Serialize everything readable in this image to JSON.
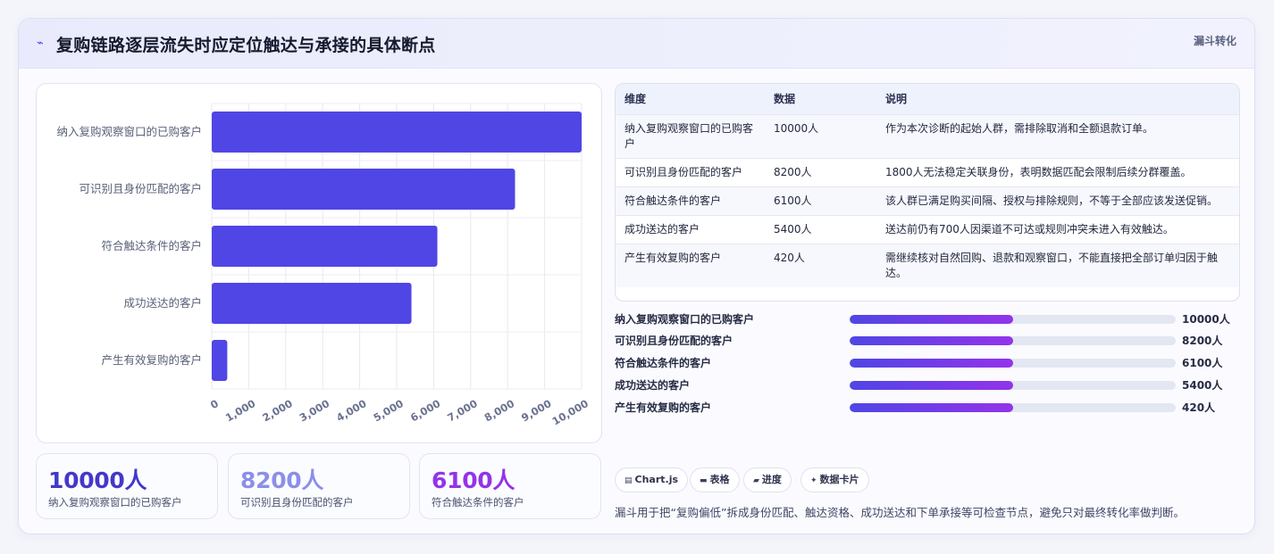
{
  "header": {
    "title_icon": "chart-spark-icon",
    "title": "复购链路逐层流失时应定位触达与承接的具体断点",
    "tag": "漏斗转化"
  },
  "colors": {
    "bar": "#4f46e5",
    "stat_1": "#4338ca",
    "stat_2": "#8b8fe8",
    "stat_3": "#9333ea",
    "progress_from": "#5046e5",
    "progress_to": "#9333ea"
  },
  "chart_data": {
    "type": "bar",
    "orientation": "horizontal",
    "categories": [
      "纳入复购观察窗口的已购客户",
      "可识别且身份匹配的客户",
      "符合触达条件的客户",
      "成功送达的客户",
      "产生有效复购的客户"
    ],
    "values": [
      10000,
      8200,
      6100,
      5400,
      420
    ],
    "xlim": [
      0,
      10000
    ],
    "x_ticks": [
      "0",
      "1,000",
      "2,000",
      "3,000",
      "4,000",
      "5,000",
      "6,000",
      "7,000",
      "8,000",
      "9,000",
      "10,000"
    ],
    "grid": true,
    "legend": "none"
  },
  "stats": [
    {
      "value": "10000人",
      "label": "纳入复购观察窗口的已购客户"
    },
    {
      "value": "8200人",
      "label": "可识别且身份匹配的客户"
    },
    {
      "value": "6100人",
      "label": "符合触达条件的客户"
    }
  ],
  "table": {
    "headers": [
      "维度",
      "数据",
      "说明"
    ],
    "rows": [
      [
        "纳入复购观察窗口的已购客户",
        "10000人",
        "作为本次诊断的起始人群，需排除取消和全额退款订单。"
      ],
      [
        "可识别且身份匹配的客户",
        "8200人",
        "1800人无法稳定关联身份，表明数据匹配会限制后续分群覆盖。"
      ],
      [
        "符合触达条件的客户",
        "6100人",
        "该人群已满足购买间隔、授权与排除规则，不等于全部应该发送促销。"
      ],
      [
        "成功送达的客户",
        "5400人",
        "送达前仍有700人因渠道不可达或规则冲突未进入有效触达。"
      ],
      [
        "产生有效复购的客户",
        "420人",
        "需继续核对自然回购、退款和观察窗口，不能直接把全部订单归因于触达。"
      ]
    ]
  },
  "progress": [
    {
      "label": "纳入复购观察窗口的已购客户",
      "value": "10000人",
      "fraction": 0.5
    },
    {
      "label": "可识别且身份匹配的客户",
      "value": "8200人",
      "fraction": 0.5
    },
    {
      "label": "符合触达条件的客户",
      "value": "6100人",
      "fraction": 0.5
    },
    {
      "label": "成功送达的客户",
      "value": "5400人",
      "fraction": 0.5
    },
    {
      "label": "产生有效复购的客户",
      "value": "420人",
      "fraction": 0.5
    }
  ],
  "chips": [
    {
      "icon": "chart-icon",
      "label": "Chart.js"
    },
    {
      "icon": "table-icon",
      "label": "表格"
    },
    {
      "icon": "progress-icon",
      "label": "进度"
    },
    {
      "icon": "sparkle-icon",
      "label": "数据卡片"
    }
  ],
  "footnote": "漏斗用于把“复购偏低”拆成身份匹配、触达资格、成功送达和下单承接等可检查节点，避免只对最终转化率做判断。"
}
